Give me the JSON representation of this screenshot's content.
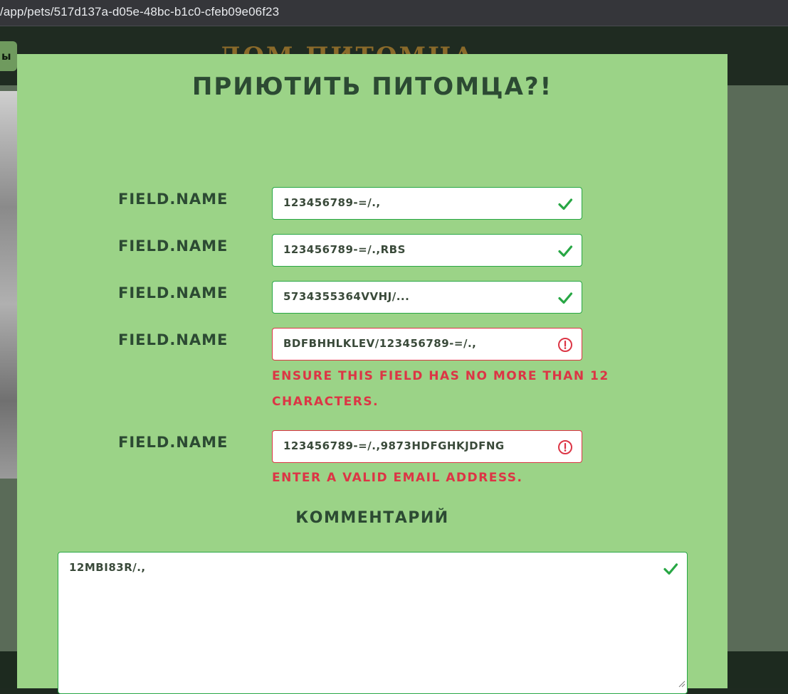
{
  "browser": {
    "url": "/app/pets/517d137a-d05e-48bc-b1c0-cfeb09e06f23"
  },
  "background_page": {
    "button_label": "ы",
    "logo_text": "ДОМ ПИТОМЦА"
  },
  "modal": {
    "title": "ПРИЮТИТЬ ПИТОМЦА?!",
    "fields": [
      {
        "label": "FIELD.NAME",
        "value": "123456789-=/.,",
        "state": "valid",
        "icon": "check-icon"
      },
      {
        "label": "FIELD.NAME",
        "value": "123456789-=/.,RBS",
        "state": "valid",
        "icon": "check-icon"
      },
      {
        "label": "FIELD.NAME",
        "value": "5734355364VVHJ/...",
        "state": "valid",
        "icon": "check-icon"
      },
      {
        "label": "FIELD.NAME",
        "value": "BDFBHHLKLEV/123456789-=/.,",
        "state": "invalid",
        "icon": "error-circle-icon",
        "error": "ENSURE THIS FIELD HAS NO MORE THAN 12 CHARACTERS."
      },
      {
        "label": "FIELD.NAME",
        "value": "123456789-=/.,9873HDFGHKJDFNG",
        "state": "invalid",
        "icon": "error-circle-icon",
        "error": "ENTER A VALID EMAIL ADDRESS."
      }
    ],
    "comment": {
      "label": "КОММЕНТАРИЙ",
      "value": "12MBI83R/.,",
      "state": "valid",
      "icon": "check-icon"
    }
  },
  "colors": {
    "modal_bg": "#9bd387",
    "heading": "#2c4a33",
    "valid": "#28a745",
    "invalid": "#dc3545"
  }
}
